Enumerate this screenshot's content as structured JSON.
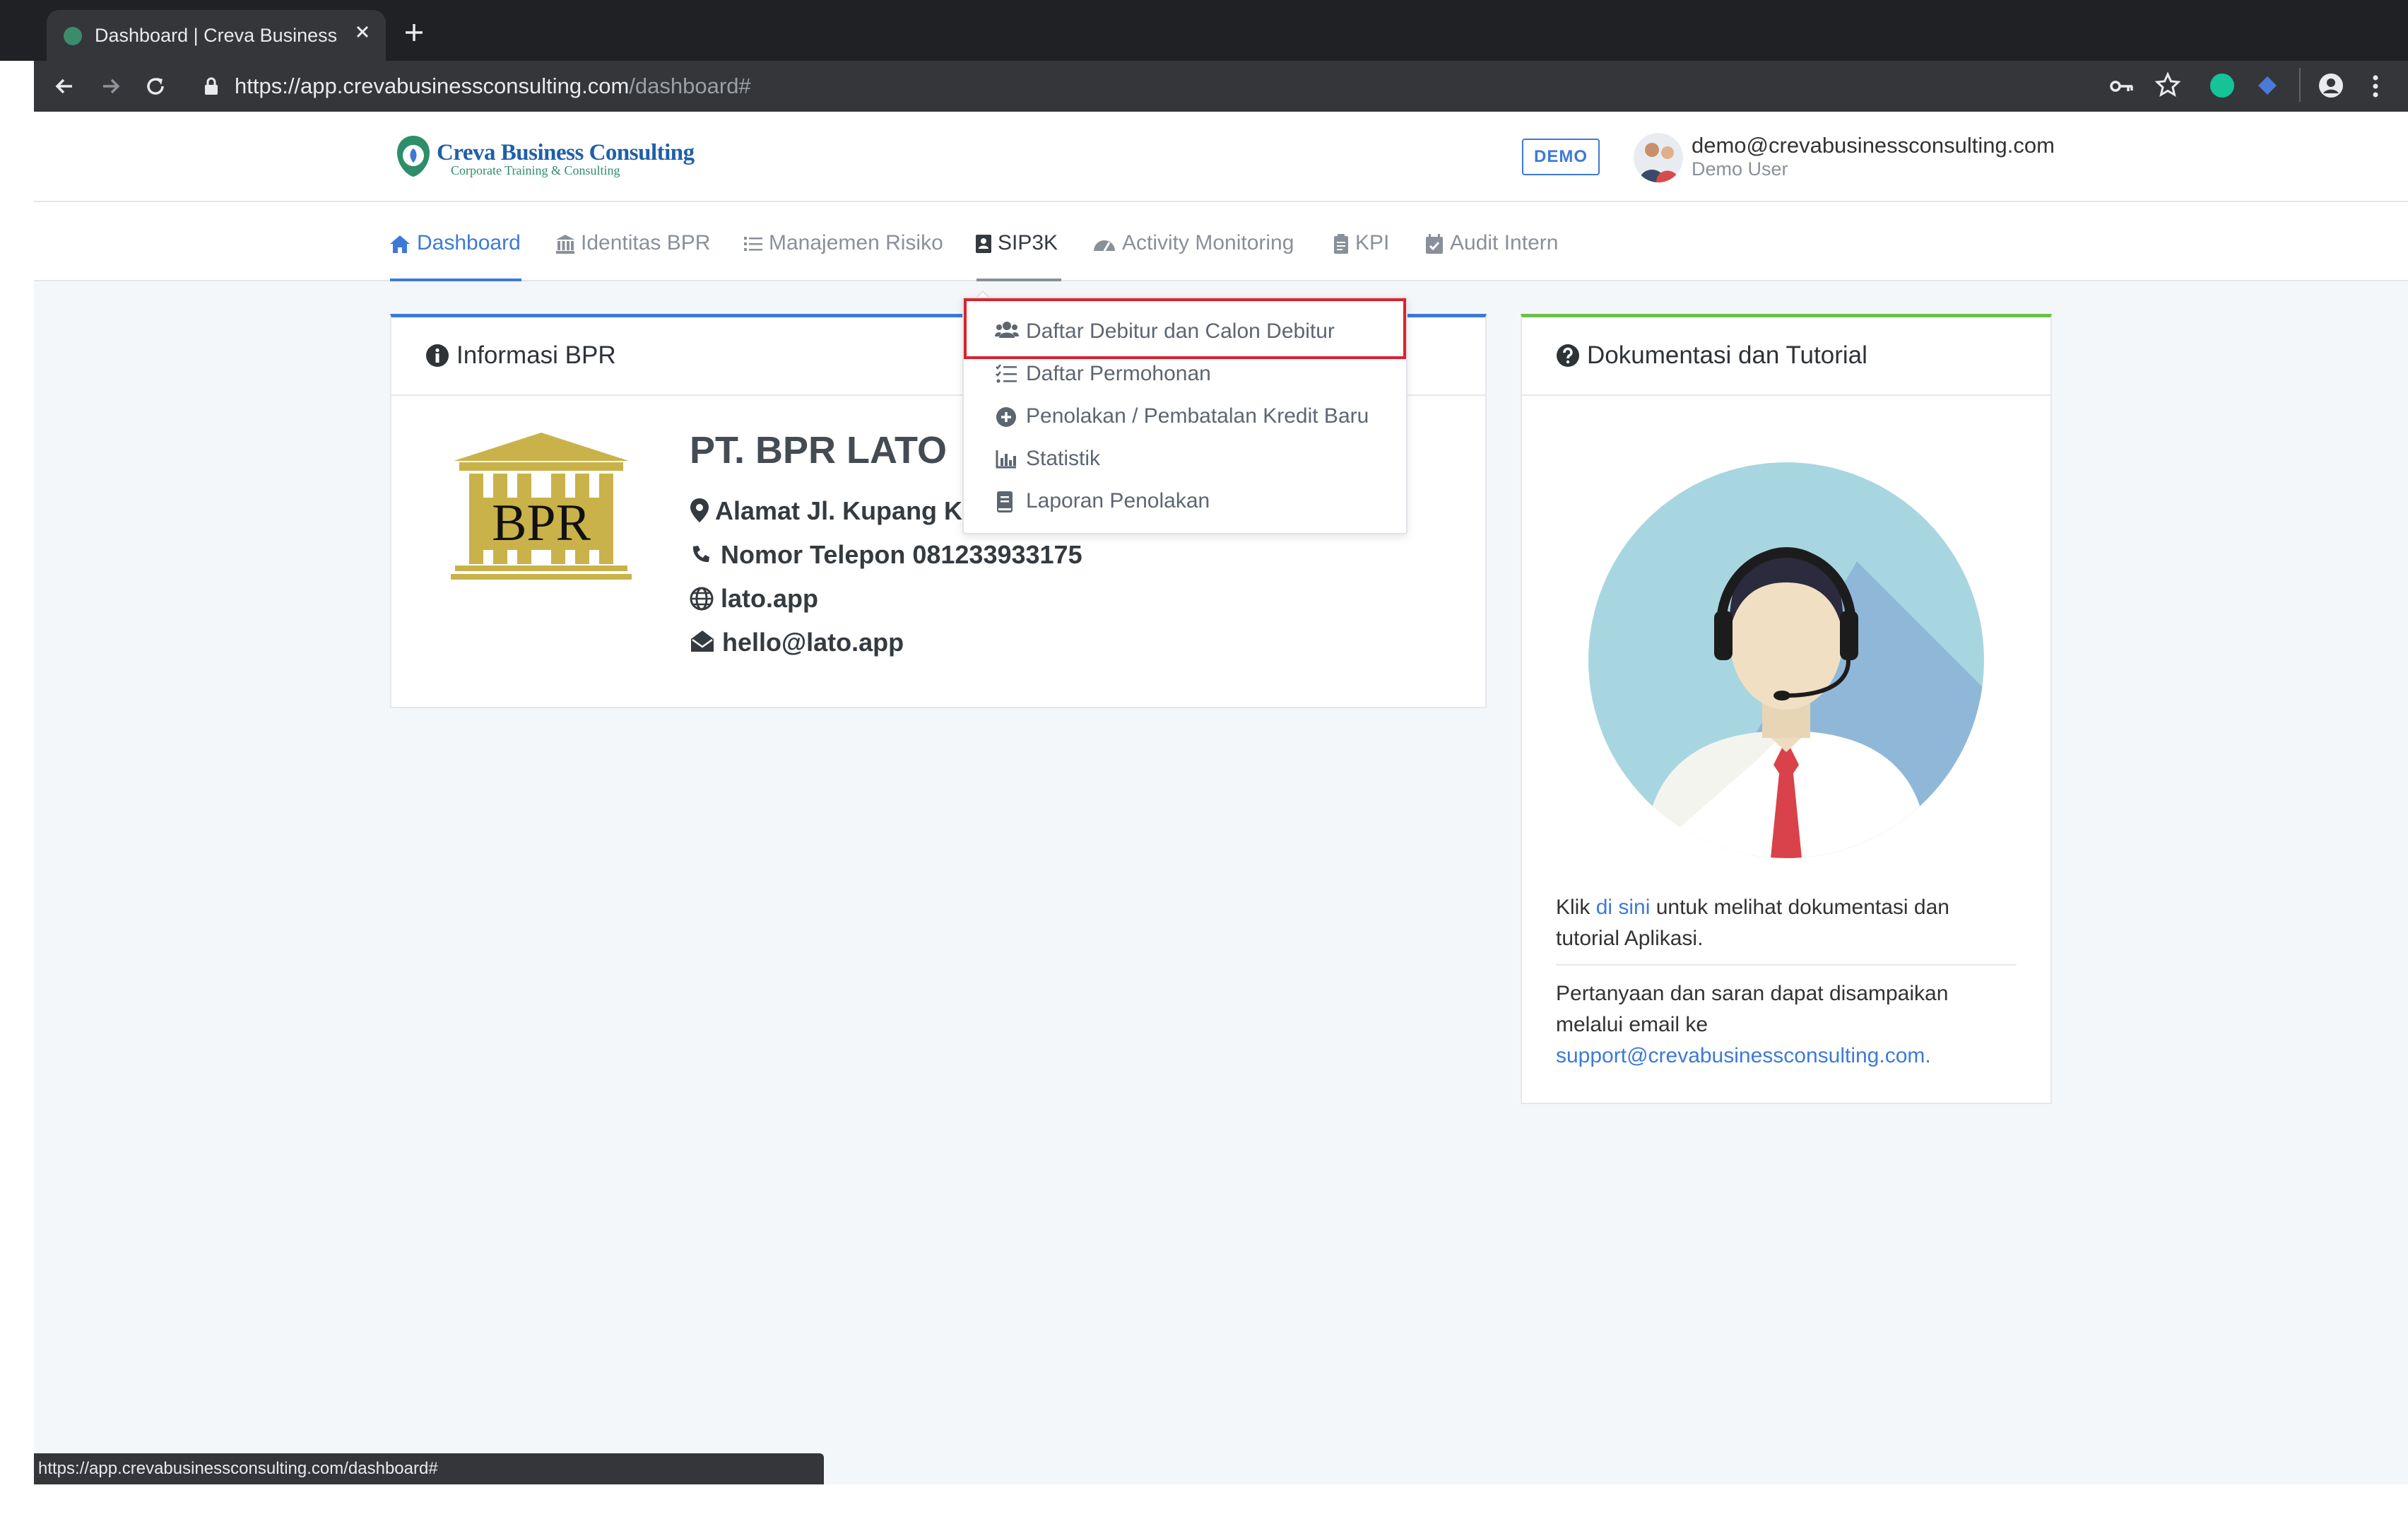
{
  "browser": {
    "tab_title": "Dashboard | Creva Business Co",
    "url_main": "https://app.crevabusinessconsulting.com",
    "url_path": "/dashboard#",
    "status_url": "https://app.crevabusinessconsulting.com/dashboard#"
  },
  "header": {
    "logo_title": "Creva Business Consulting",
    "logo_subtitle": "Corporate Training & Consulting",
    "demo_badge": "DEMO",
    "user_email": "demo@crevabusinessconsulting.com",
    "user_name": "Demo User"
  },
  "nav": {
    "items": [
      {
        "label": "Dashboard",
        "icon": "home-icon",
        "active": true
      },
      {
        "label": "Identitas BPR",
        "icon": "bank-icon"
      },
      {
        "label": "Manajemen Risiko",
        "icon": "list-icon"
      },
      {
        "label": "SIP3K",
        "icon": "id-card-icon",
        "open": true
      },
      {
        "label": "Activity Monitoring",
        "icon": "gauge-icon"
      },
      {
        "label": "KPI",
        "icon": "clipboard-icon"
      },
      {
        "label": "Audit Intern",
        "icon": "calendar-check-icon"
      }
    ]
  },
  "dropdown": {
    "items": [
      {
        "label": "Daftar Debitur dan Calon Debitur",
        "icon": "users-icon",
        "highlighted": true
      },
      {
        "label": "Daftar Permohonan",
        "icon": "list-check-icon"
      },
      {
        "label": "Penolakan / Pembatalan Kredit Baru",
        "icon": "plus-circle-icon"
      },
      {
        "label": "Statistik",
        "icon": "bar-chart-icon"
      },
      {
        "label": "Laporan Penolakan",
        "icon": "book-icon"
      }
    ]
  },
  "info_panel": {
    "title": "Informasi BPR",
    "logo_text": "BPR",
    "company_name": "PT. BPR LATO",
    "address": "Alamat Jl. Kupang Kr",
    "phone": "Nomor Telepon 081233933175",
    "website": "lato.app",
    "email": "hello@lato.app"
  },
  "doc_panel": {
    "title": "Dokumentasi dan Tutorial",
    "text1_pre": "Klik ",
    "text1_link": "di sini",
    "text1_post": " untuk melihat dokumentasi dan tutorial Aplikasi.",
    "text2": "Pertanyaan dan saran dapat disampaikan melalui email ke",
    "support_email": "support@crevabusinessconsulting.com."
  },
  "colors": {
    "accent_blue": "#3d7ad6",
    "accent_green": "#6cc04a",
    "highlight_red": "#d9232d",
    "chrome_dark": "#202124"
  }
}
